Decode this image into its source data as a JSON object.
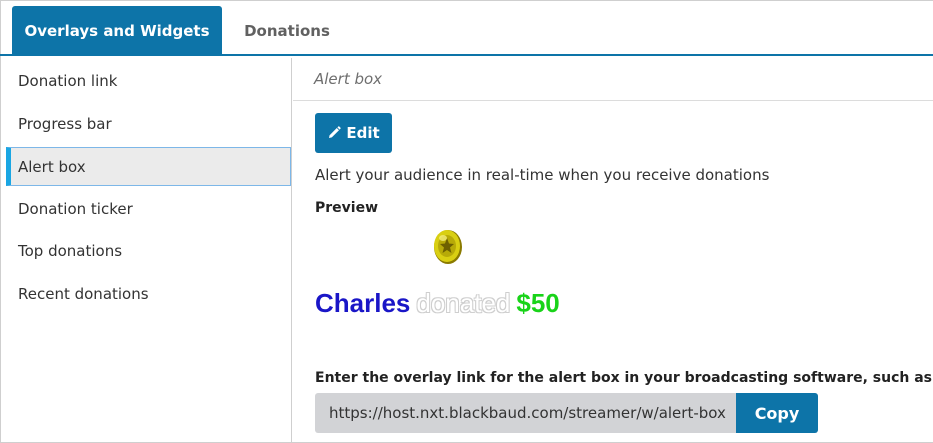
{
  "tabs": [
    {
      "label": "Overlays and Widgets",
      "active": true
    },
    {
      "label": "Donations",
      "active": false
    }
  ],
  "sidebar": {
    "items": [
      {
        "label": "Donation link",
        "active": false
      },
      {
        "label": "Progress bar",
        "active": false
      },
      {
        "label": "Alert box",
        "active": true
      },
      {
        "label": "Donation ticker",
        "active": false
      },
      {
        "label": "Top donations",
        "active": false
      },
      {
        "label": "Recent donations",
        "active": false
      }
    ]
  },
  "main": {
    "header": "Alert box",
    "edit_label": "Edit",
    "description": "Alert your audience in real-time when you receive donations",
    "preview_label": "Preview",
    "preview": {
      "donor": "Charles",
      "verb": "donated",
      "amount": "$50"
    },
    "overlay_link_label": "Enter the overlay link for the alert box in your broadcasting software, such as OBS",
    "overlay_link_value": "https://host.nxt.blackbaud.com/streamer/w/alert-box",
    "copy_label": "Copy"
  },
  "colors": {
    "accent": "#0d74a8",
    "active_indicator": "#1aa6e3",
    "donor_name": "#1a16c7",
    "amount": "#19d319",
    "input_bg": "#d2d3d6"
  },
  "icons": {
    "edit": "pencil-icon",
    "preview_image": "gold-coin-icon"
  }
}
